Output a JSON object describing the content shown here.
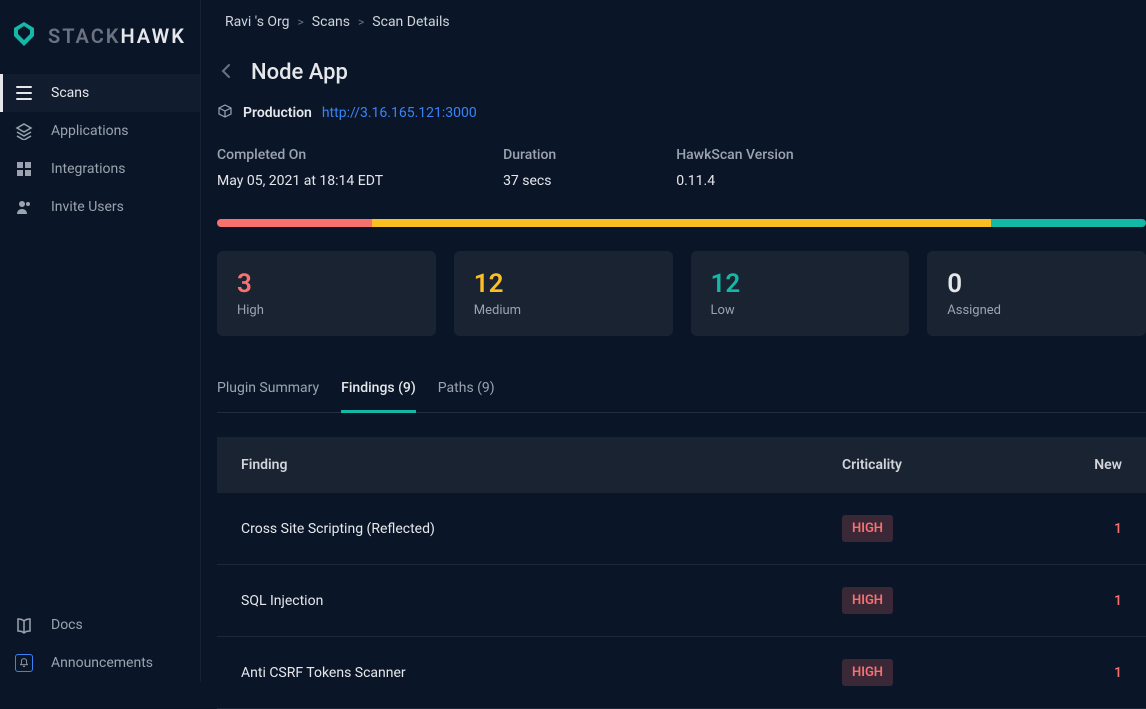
{
  "logo": {
    "stack": "STACK",
    "hawk": "HAWK"
  },
  "sidebar": {
    "items": [
      {
        "label": "Scans"
      },
      {
        "label": "Applications"
      },
      {
        "label": "Integrations"
      },
      {
        "label": "Invite Users"
      }
    ],
    "bottom": [
      {
        "label": "Docs"
      },
      {
        "label": "Announcements"
      }
    ]
  },
  "breadcrumb": {
    "a": "Ravi 's Org",
    "b": "Scans",
    "c": "Scan Details"
  },
  "page": {
    "title": "Node App",
    "env_label": "Production",
    "env_url": "http://3.16.165.121:3000"
  },
  "meta": {
    "completed_label": "Completed On",
    "completed_value": "May 05, 2021 at 18:14 EDT",
    "duration_label": "Duration",
    "duration_value": "37 secs",
    "version_label": "HawkScan Version",
    "version_value": "0.11.4"
  },
  "counts": {
    "high": {
      "num": "3",
      "label": "High"
    },
    "medium": {
      "num": "12",
      "label": "Medium"
    },
    "low": {
      "num": "12",
      "label": "Low"
    },
    "assigned": {
      "num": "0",
      "label": "Assigned"
    }
  },
  "tabs": {
    "plugin": "Plugin Summary",
    "findings": "Findings (9)",
    "paths": "Paths (9)"
  },
  "table": {
    "headers": {
      "finding": "Finding",
      "crit": "Criticality",
      "new": "New"
    },
    "rows": [
      {
        "finding": "Cross Site Scripting (Reflected)",
        "crit": "HIGH",
        "new": "1"
      },
      {
        "finding": "SQL Injection",
        "crit": "HIGH",
        "new": "1"
      },
      {
        "finding": "Anti CSRF Tokens Scanner",
        "crit": "HIGH",
        "new": "1"
      }
    ]
  },
  "colors": {
    "high": "#f87171",
    "medium": "#fbbf24",
    "low": "#14b8a6"
  }
}
